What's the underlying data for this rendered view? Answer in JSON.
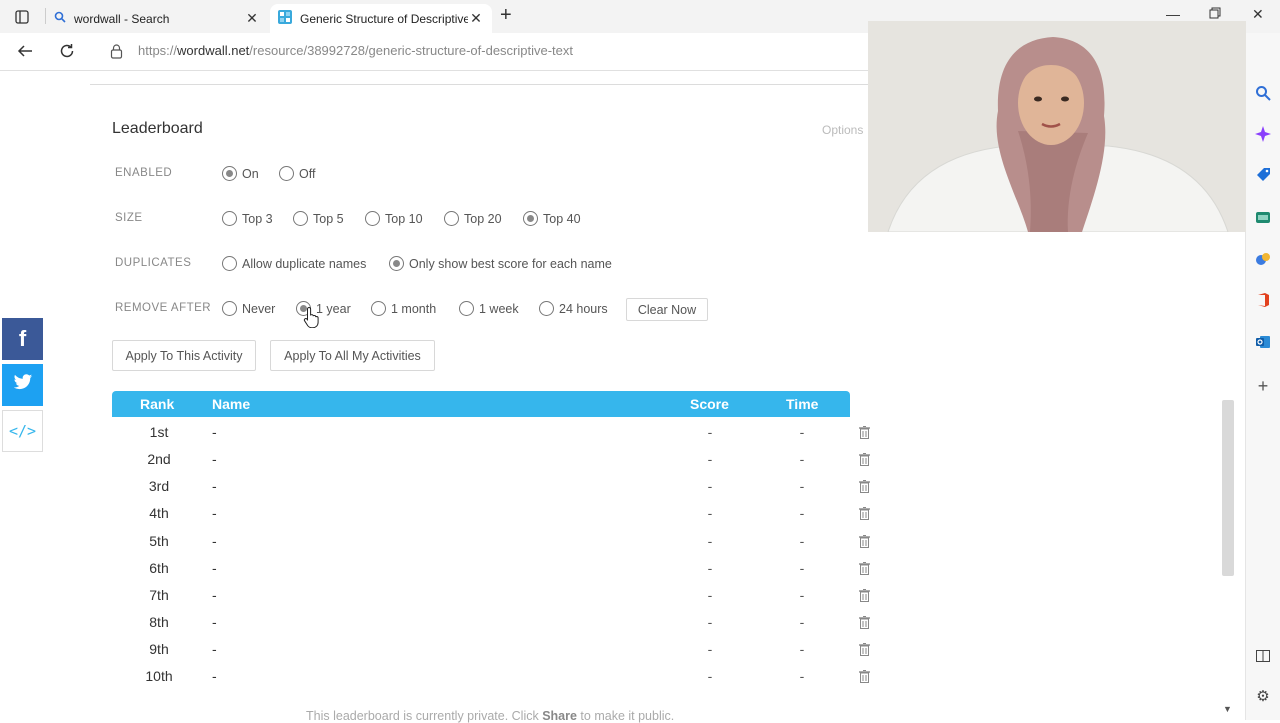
{
  "browser": {
    "tab1_title": "wordwall - Search",
    "tab2_title": "Generic Structure of Descriptive",
    "url_prefix": "https://",
    "url_host": "wordwall.net",
    "url_path": "/resource/38992728/generic-structure-of-descriptive-text"
  },
  "leaderboard": {
    "title": "Leaderboard",
    "options_label": "Options",
    "enabled": {
      "label": "ENABLED",
      "options": [
        "On",
        "Off"
      ],
      "selected": "On"
    },
    "size": {
      "label": "SIZE",
      "options": [
        "Top 3",
        "Top 5",
        "Top 10",
        "Top 20",
        "Top 40"
      ],
      "selected": "Top 40"
    },
    "duplicates": {
      "label": "DUPLICATES",
      "options": [
        "Allow duplicate names",
        "Only show best score for each name"
      ],
      "selected": "Only show best score for each name"
    },
    "remove_after": {
      "label": "REMOVE AFTER",
      "options": [
        "Never",
        "1 year",
        "1 month",
        "1 week",
        "24 hours"
      ],
      "selected": "1 year",
      "clear_now": "Clear Now"
    },
    "apply_this": "Apply To This Activity",
    "apply_all": "Apply To All My Activities",
    "table": {
      "headers": {
        "rank": "Rank",
        "name": "Name",
        "score": "Score",
        "time": "Time"
      },
      "rows": [
        {
          "rank": "1st",
          "name": "-",
          "score": "-",
          "time": "-"
        },
        {
          "rank": "2nd",
          "name": "-",
          "score": "-",
          "time": "-"
        },
        {
          "rank": "3rd",
          "name": "-",
          "score": "-",
          "time": "-"
        },
        {
          "rank": "4th",
          "name": "-",
          "score": "-",
          "time": "-"
        },
        {
          "rank": "5th",
          "name": "-",
          "score": "-",
          "time": "-"
        },
        {
          "rank": "6th",
          "name": "-",
          "score": "-",
          "time": "-"
        },
        {
          "rank": "7th",
          "name": "-",
          "score": "-",
          "time": "-"
        },
        {
          "rank": "8th",
          "name": "-",
          "score": "-",
          "time": "-"
        },
        {
          "rank": "9th",
          "name": "-",
          "score": "-",
          "time": "-"
        },
        {
          "rank": "10th",
          "name": "-",
          "score": "-",
          "time": "-"
        }
      ]
    },
    "footer": {
      "before": "This leaderboard is currently private. Click ",
      "bold": "Share",
      "after": " to make it public."
    }
  },
  "colors": {
    "table_header": "#36b6ec",
    "facebook": "#3b5998",
    "twitter": "#1da1f2"
  },
  "icons": {
    "social": [
      "facebook-icon",
      "twitter-icon",
      "embed-icon"
    ],
    "sidebar": [
      "search-icon",
      "copilot-icon",
      "shopping-icon",
      "games-icon",
      "tools-icon",
      "office-icon",
      "outlook-icon",
      "add-icon"
    ]
  }
}
